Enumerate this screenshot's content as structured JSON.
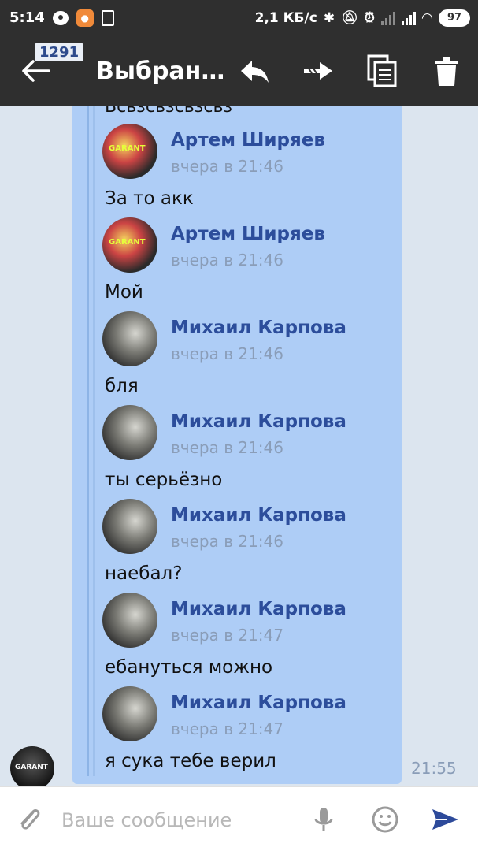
{
  "status_bar": {
    "time": "5:14",
    "speed": "2,1 КБ/с",
    "battery": "97"
  },
  "toolbar": {
    "count": "1291",
    "title": "Выбран…"
  },
  "chat": {
    "cut_text": "Всвзсвзсвзсвз",
    "messages": [
      {
        "author": "Артем Ширяев",
        "time": "вчера в 21:46",
        "text": "За то акк"
      },
      {
        "author": "Артем Ширяев",
        "time": "вчера в 21:46",
        "text": "Мой"
      },
      {
        "author": "Михаил Карпова",
        "time": "вчера в 21:46",
        "text": "бля"
      },
      {
        "author": "Михаил Карпова",
        "time": "вчера в 21:46",
        "text": "ты серьёзно"
      },
      {
        "author": "Михаил Карпова",
        "time": "вчера в 21:46",
        "text": "наебал?"
      },
      {
        "author": "Михаил Карпова",
        "time": "вчера в 21:47",
        "text": "ебануться можно"
      },
      {
        "author": "Михаил Карпова",
        "time": "вчера в 21:47",
        "text": "я сука тебе верил"
      }
    ],
    "sent_time": "21:55"
  },
  "input": {
    "placeholder": "Ваше сообщение"
  },
  "colors": {
    "bar": "#2f2f2f",
    "bubble": "#aecdf6",
    "author": "#2c4d9b",
    "send": "#2d4a9a"
  },
  "icons": [
    "reply-icon",
    "forward-icon",
    "copy-icon",
    "delete-icon",
    "attach-icon",
    "mic-icon",
    "emoji-icon",
    "send-icon"
  ]
}
